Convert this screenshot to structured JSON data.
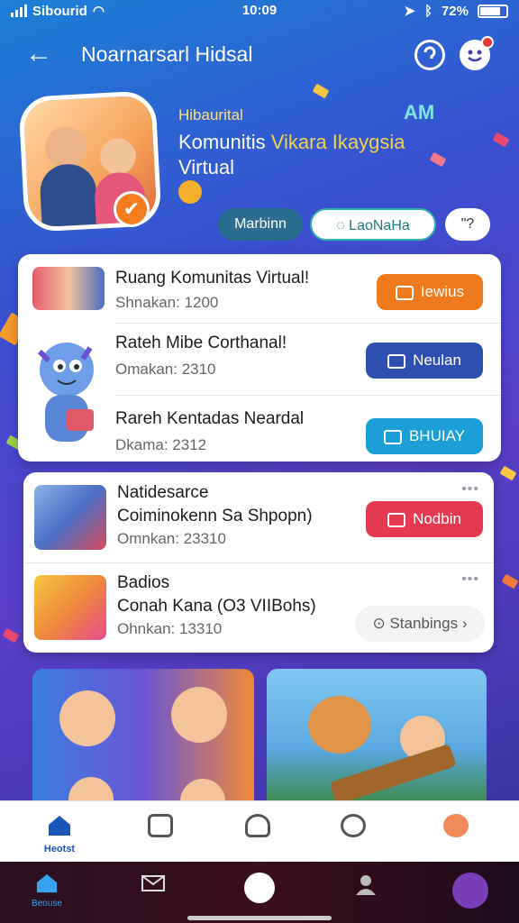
{
  "status": {
    "carrier": "Sibourid",
    "time": "10:09",
    "battery": "72%"
  },
  "header": {
    "title": "Noarnarsarl Hidsal"
  },
  "hero": {
    "small": "Hibaurital",
    "line1_white": "Komunitis ",
    "line1_yellow": "Vikara Ikaygsia",
    "line2": "Virtual",
    "tag": "AM",
    "chips": [
      "Marbinn",
      "LaoNaHa",
      "\"?"
    ]
  },
  "card1": {
    "rows": [
      {
        "title": "Ruang Komunitas Virtual!",
        "sub": "Shnakan: 1200",
        "action": "Iewius",
        "color": "#f07a1e"
      },
      {
        "title": "Rateh Mibe Corthanal!",
        "sub": "Omakan: 2310",
        "action": "Neulan",
        "color": "#2c4fb0"
      },
      {
        "title": "Rareh Kentadas Neardal",
        "sub": "Dkama: 2312",
        "action": "BHUIAY",
        "color": "#1c9ed6"
      }
    ]
  },
  "card2": {
    "rows": [
      {
        "title": "Natidesarce",
        "title2": "Coiminokenn Sa Shpopn)",
        "sub": "Omnkan: 23310",
        "action": "Nodbin",
        "color": "#e53950"
      },
      {
        "title": "Badios",
        "title2": "Conah Kana (O3 VIIBohs)",
        "sub": "Ohnkan: 13310",
        "action": "Stanbings"
      }
    ]
  },
  "tabbar1": {
    "active_label": "Heotst"
  },
  "tabbar2": {
    "active_label": "Beouse"
  }
}
